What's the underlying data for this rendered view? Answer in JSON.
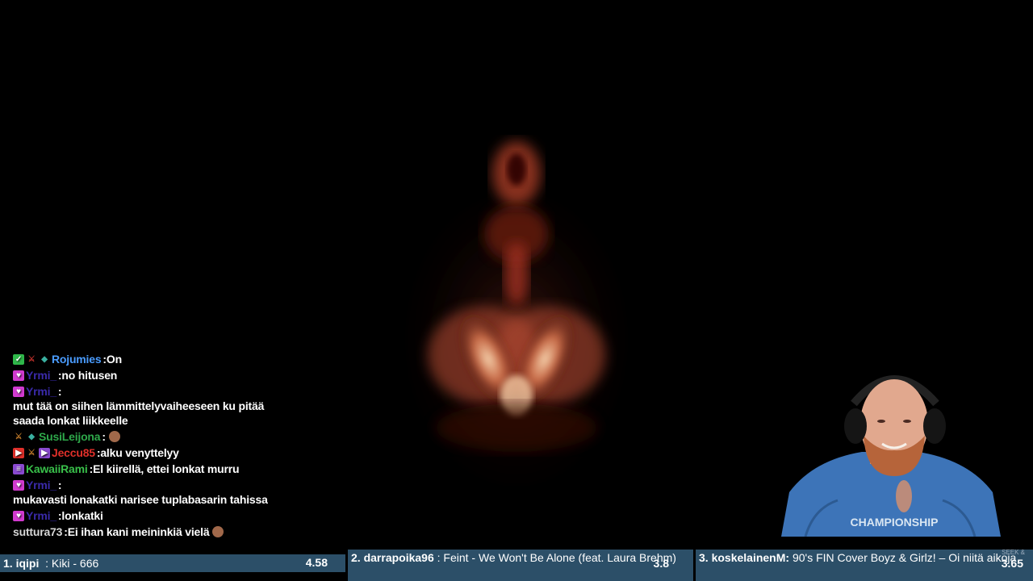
{
  "chat": [
    {
      "user": "Rojumies",
      "user_color": "#4a9cff",
      "message": "On",
      "badges": [
        "check",
        "sword",
        "gem"
      ]
    },
    {
      "user": "Yrmi_",
      "user_color": "#3a2aaa",
      "message": "no hitusen",
      "badges": [
        "heart"
      ]
    },
    {
      "user": "Yrmi_",
      "user_color": "#3a2aaa",
      "message": "mut tää on siihen lämmittelyvaiheeseen ku pitää saada lonkat liikkeelle",
      "badges": [
        "heart"
      ]
    },
    {
      "user": "SusiLeijona",
      "user_color": "#2ea84a",
      "message": "",
      "badges": [
        "wolf",
        "gem"
      ],
      "emote": true
    },
    {
      "user": "Jeccu85",
      "user_color": "#e0302a",
      "message": "alku venyttelyy",
      "badges": [
        "video",
        "wolf",
        "video2"
      ]
    },
    {
      "user": "KawaiiRami",
      "user_color": "#39c04a",
      "message": "El kiirellä, ettei lonkat murru",
      "badges": [
        "purple"
      ]
    },
    {
      "user": "Yrmi_",
      "user_color": "#3a2aaa",
      "message": "mukavasti lonakatki narisee tuplabasarin tahissa",
      "badges": [
        "heart"
      ]
    },
    {
      "user": "Yrmi_",
      "user_color": "#3a2aaa",
      "message": "lonkatki",
      "badges": [
        "heart"
      ]
    },
    {
      "user": "suttura73",
      "user_color": "#d8d8d8",
      "message": "Ei ihan kani meininkiä vielä",
      "badges": [],
      "emote": true
    }
  ],
  "queue": [
    {
      "rank": "1.",
      "user": "iqipi",
      "text": "Kiki - 666",
      "score": "4.58"
    },
    {
      "rank": "2.",
      "user": "darrapoika96",
      "text": "Feint - We Won't Be Alone (feat. Laura Brehm)",
      "score": "3.8"
    },
    {
      "rank": "3.",
      "user": "koskelainenM:",
      "text": "90's FIN Cover Boyz & Girlz! – Oi niitä aikoja",
      "score": "3.65"
    }
  ],
  "seek_label": "SEEK &",
  "colors": {
    "queue_bg": "#2c4f68",
    "background": "#000000"
  }
}
